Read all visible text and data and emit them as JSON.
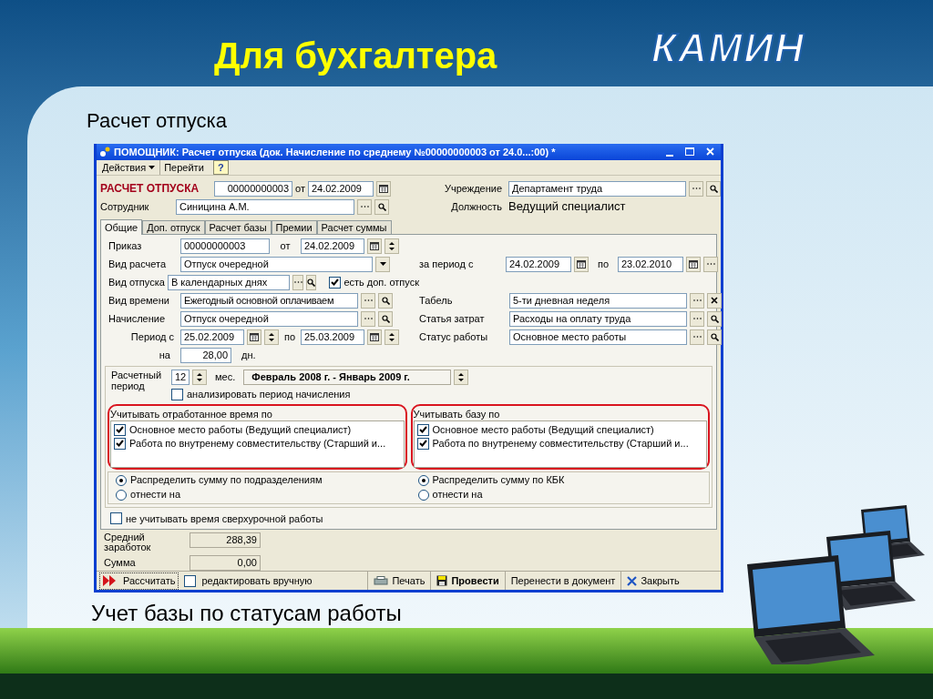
{
  "slide": {
    "title": "Для бухгалтера",
    "logo": "КАМИН",
    "subtitle": "Расчет отпуска",
    "caption": "Учет базы по статусам работы"
  },
  "window": {
    "title": "ПОМОЩНИК: Расчет отпуска (док. Начисление по среднему №00000000003 от 24.0...:00) *"
  },
  "toolbar": {
    "actions": "Действия",
    "goto": "Перейти",
    "help": "?"
  },
  "header": {
    "doc_title": "РАСЧЕТ ОТПУСКА",
    "number": "00000000003",
    "from_label": "от",
    "date": "24.02.2009",
    "institution_label": "Учреждение",
    "institution": "Департамент труда",
    "employee_label": "Сотрудник",
    "employee": "Синицина А.М.",
    "position_label": "Должность",
    "position": "Ведущий специалист"
  },
  "tabs": [
    {
      "label": "Общие",
      "selected": true
    },
    {
      "label": "Доп. отпуск",
      "selected": false
    },
    {
      "label": "Расчет базы",
      "selected": false
    },
    {
      "label": "Премии",
      "selected": false
    },
    {
      "label": "Расчет суммы",
      "selected": false
    }
  ],
  "general": {
    "order_label": "Приказ",
    "order": "00000000003",
    "order_from_label": "от",
    "order_date": "24.02.2009",
    "calc_type_label": "Вид расчета",
    "calc_type": "Отпуск очередной",
    "period_label": "за период с",
    "period_from": "24.02.2009",
    "period_to_label": "по",
    "period_to": "23.02.2010",
    "leave_type_label": "Вид отпуска",
    "leave_type": "В календарных днях",
    "extra_leave": {
      "label": "есть доп. отпуск",
      "checked": true
    },
    "time_type_label": "Вид времени",
    "time_type": "Ежегодный основной оплачиваем",
    "timesheet_label": "Табель",
    "timesheet": "5-ти дневная неделя",
    "accrual_label": "Начисление",
    "accrual": "Отпуск очередной",
    "cost_label": "Статья затрат",
    "cost": "Расходы на оплату труда",
    "leave_from_label": "Период с",
    "leave_from": "25.02.2009",
    "leave_to_label": "по",
    "leave_to": "25.03.2009",
    "work_status_label": "Статус работы",
    "work_status": "Основное место работы",
    "days_label": "на",
    "days": "28,00",
    "days_unit": "дн.",
    "calc_period_label": "Расчетный период",
    "months": "12",
    "months_unit": "мес.",
    "calc_period": "Февраль 2008 г. - Январь 2009 г.",
    "analyze": {
      "label": "анализировать период начисления",
      "checked": false
    },
    "lists": [
      {
        "title": "Учитывать отработанное время по",
        "items": [
          {
            "label": "Основное место работы (Ведущий специалист)",
            "checked": true
          },
          {
            "label": "Работа по внутренему совместительству (Старший и...",
            "checked": true
          }
        ]
      },
      {
        "title": "Учитывать базу по",
        "items": [
          {
            "label": "Основное место работы (Ведущий специалист)",
            "checked": true
          },
          {
            "label": "Работа по внутренему совместительству (Старший и...",
            "checked": true
          }
        ]
      }
    ],
    "radio_groups": [
      [
        {
          "label": "Распределить сумму по подразделениям",
          "selected": true
        },
        {
          "label": "отнести на",
          "selected": false
        }
      ],
      [
        {
          "label": "Распределить сумму по КБК",
          "selected": true
        },
        {
          "label": "отнести на",
          "selected": false
        }
      ]
    ],
    "overtime": {
      "label": "не учитывать время сверхурочной работы",
      "checked": false
    },
    "avg_label": "Средний заработок",
    "avg": "288,39",
    "sum_label": "Сумма",
    "sum": "0,00"
  },
  "bottom_bar": {
    "calculate": "Рассчитать",
    "manual_edit": {
      "label": "редактировать вручную",
      "checked": false
    },
    "buttons": [
      {
        "kind": "print",
        "label": "Печать"
      },
      {
        "kind": "post",
        "label": "Провести"
      },
      {
        "kind": "transfer",
        "label": "Перенести в документ"
      },
      {
        "kind": "close",
        "label": "Закрыть"
      }
    ]
  }
}
